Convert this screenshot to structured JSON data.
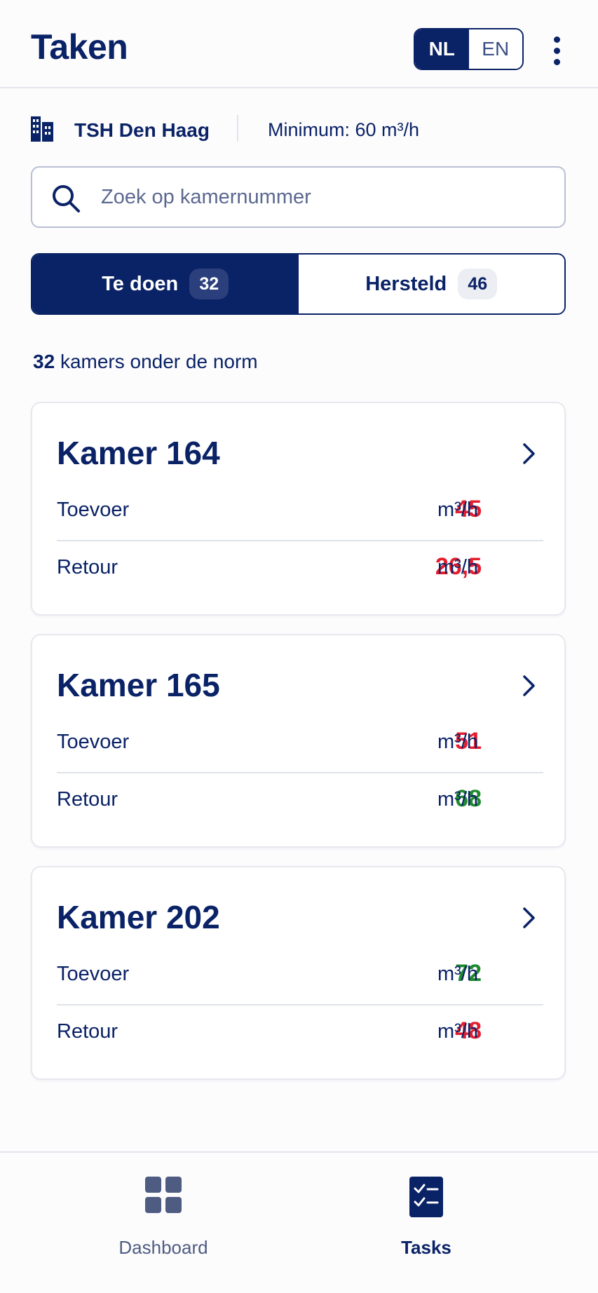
{
  "header": {
    "title": "Taken",
    "languages": [
      {
        "label": "NL",
        "active": true
      },
      {
        "label": "EN",
        "active": false
      }
    ],
    "menu_icon": "more-vertical-icon"
  },
  "site": {
    "icon": "building-icon",
    "name": "TSH Den Haag",
    "minimum": "Minimum: 60 m³/h"
  },
  "search": {
    "icon": "search-icon",
    "placeholder": "Zoek op kamernummer",
    "value": ""
  },
  "tabs": [
    {
      "label": "Te doen",
      "count": "32",
      "active": true
    },
    {
      "label": "Hersteld",
      "count": "46",
      "active": false
    }
  ],
  "summary": {
    "count": "32",
    "text": "kamers onder de norm"
  },
  "rooms": [
    {
      "title": "Kamer 164",
      "supply_label": "Toevoer",
      "supply_value": "45",
      "supply_status": "bad",
      "return_label": "Retour",
      "return_value": "26,5",
      "return_status": "bad",
      "unit": "m³/h"
    },
    {
      "title": "Kamer 165",
      "supply_label": "Toevoer",
      "supply_value": "51",
      "supply_status": "bad",
      "return_label": "Retour",
      "return_value": "68",
      "return_status": "good",
      "unit": "m³/h"
    },
    {
      "title": "Kamer 202",
      "supply_label": "Toevoer",
      "supply_value": "72",
      "supply_status": "good",
      "return_label": "Retour",
      "return_value": "48",
      "return_status": "bad",
      "unit": "m³/h"
    }
  ],
  "colors": {
    "primary": "#0a2266",
    "bad": "#e51d2e",
    "good": "#1f8a2e"
  },
  "bottom_nav": [
    {
      "label": "Dashboard",
      "icon": "dashboard-grid-icon",
      "active": false
    },
    {
      "label": "Tasks",
      "icon": "tasks-checklist-icon",
      "active": true
    }
  ]
}
